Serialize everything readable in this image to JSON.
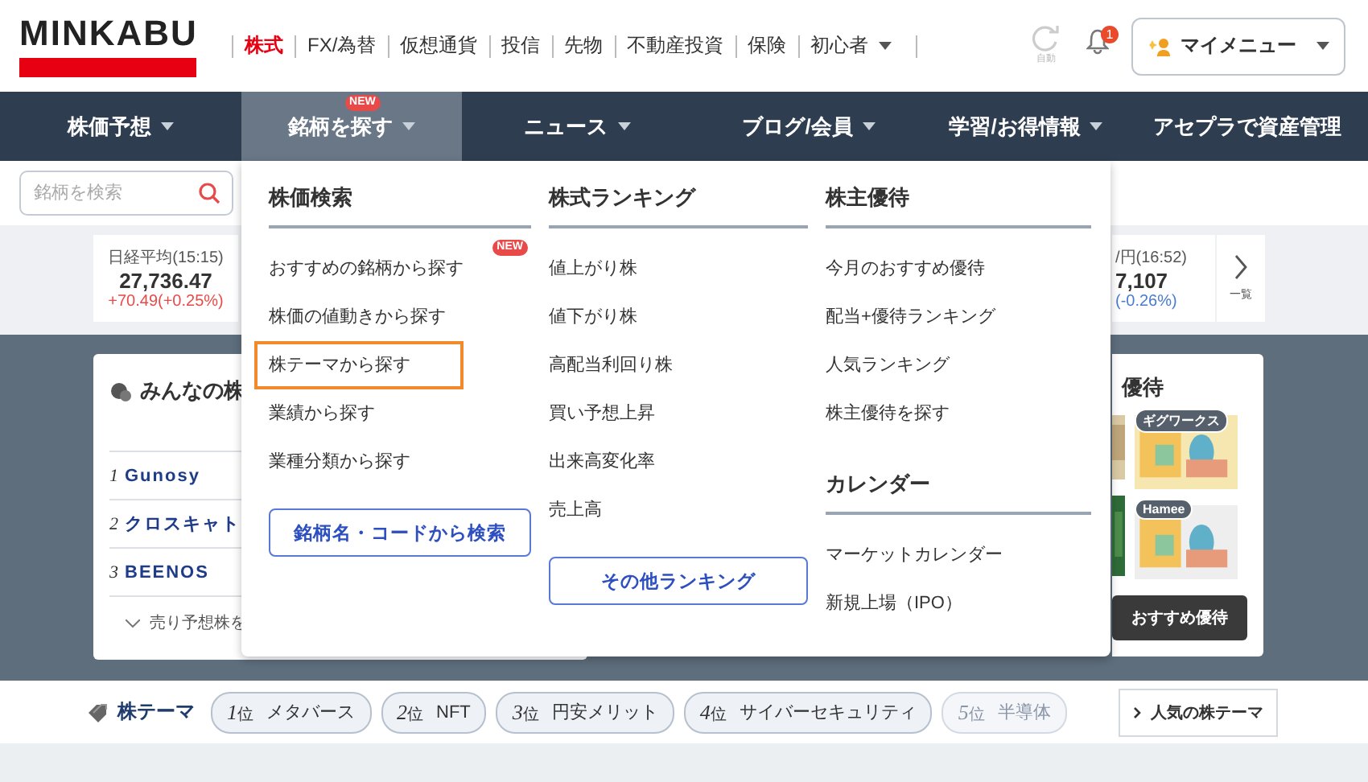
{
  "logo": {
    "text": "MINKABU"
  },
  "top_nav": [
    {
      "label": "株式",
      "selected": true,
      "dropdown": false
    },
    {
      "label": "FX/為替",
      "selected": false,
      "dropdown": false
    },
    {
      "label": "仮想通貨",
      "selected": false,
      "dropdown": false
    },
    {
      "label": "投信",
      "selected": false,
      "dropdown": false
    },
    {
      "label": "先物",
      "selected": false,
      "dropdown": false
    },
    {
      "label": "不動産投資",
      "selected": false,
      "dropdown": false
    },
    {
      "label": "保険",
      "selected": false,
      "dropdown": false
    },
    {
      "label": "初心者",
      "selected": false,
      "dropdown": true
    }
  ],
  "auto_refresh": {
    "label": "自動"
  },
  "notifications": {
    "count": "1"
  },
  "my_menu": {
    "label": "マイメニュー"
  },
  "main_nav": [
    {
      "label": "株価予想",
      "selected": false,
      "dropdown": true
    },
    {
      "label": "銘柄を探す",
      "selected": true,
      "dropdown": true,
      "badge": "NEW"
    },
    {
      "label": "ニュース",
      "selected": false,
      "dropdown": true
    },
    {
      "label": "ブログ/会員",
      "selected": false,
      "dropdown": true
    },
    {
      "label": "学習/お得情報",
      "selected": false,
      "dropdown": true
    },
    {
      "label": "アセプラで資産管理",
      "selected": false,
      "dropdown": false
    }
  ],
  "search": {
    "placeholder": "銘柄を検索"
  },
  "tickers": [
    {
      "name": "日経平均(15:15)",
      "value": "27,736.47",
      "change": "+70.49(+0.25%)",
      "color": "#e84a4a"
    },
    {
      "name": "/円(16:52)",
      "value": "7,107",
      "change": "(-0.26%)",
      "color": "#4a7bd0"
    }
  ],
  "ticker_more": {
    "label": "一覧"
  },
  "community_card": {
    "title": "みんなの株",
    "rows": [
      {
        "rank": "1",
        "name": "Gunosy"
      },
      {
        "rank": "2",
        "name": "クロスキャト"
      },
      {
        "rank": "3",
        "name": "BEENOS"
      }
    ],
    "more": "売り予想株を"
  },
  "benefits_card": {
    "title": "優待",
    "items": [
      {
        "tag": "ギグワークス"
      },
      {
        "tag": "Hamee"
      }
    ],
    "button": "おすすめ優待"
  },
  "dropdown": {
    "columns": [
      {
        "sections": [
          {
            "heading": "株価検索",
            "items": [
              {
                "label": "おすすめの銘柄から探す",
                "badge": "NEW",
                "selected": false
              },
              {
                "label": "株価の値動きから探す",
                "selected": false
              },
              {
                "label": "株テーマから探す",
                "selected": true
              },
              {
                "label": "業績から探す",
                "selected": false
              },
              {
                "label": "業種分類から探す",
                "selected": false
              }
            ]
          }
        ],
        "button": "銘柄名・コードから検索"
      },
      {
        "sections": [
          {
            "heading": "株式ランキング",
            "items": [
              {
                "label": "値上がり株",
                "selected": false
              },
              {
                "label": "値下がり株",
                "selected": false
              },
              {
                "label": "高配当利回り株",
                "selected": false
              },
              {
                "label": "買い予想上昇",
                "selected": false
              },
              {
                "label": "出来高変化率",
                "selected": false
              },
              {
                "label": "売上高",
                "selected": false
              }
            ]
          }
        ],
        "button": "その他ランキング"
      },
      {
        "sections": [
          {
            "heading": "株主優待",
            "items": [
              {
                "label": "今月のおすすめ優待",
                "selected": false
              },
              {
                "label": "配当+優待ランキング",
                "selected": false
              },
              {
                "label": "人気ランキング",
                "selected": false
              },
              {
                "label": "株主優待を探す",
                "selected": false
              }
            ]
          },
          {
            "heading": "カレンダー",
            "items": [
              {
                "label": "マーケットカレンダー",
                "selected": false
              },
              {
                "label": "新規上場（IPO）",
                "selected": false
              }
            ]
          }
        ]
      }
    ]
  },
  "theme_bar": {
    "title": "株テーマ",
    "themes": [
      {
        "rank": "1",
        "rank_unit": "位",
        "label": "メタバース",
        "faded": false
      },
      {
        "rank": "2",
        "rank_unit": "位",
        "label": "NFT",
        "faded": false
      },
      {
        "rank": "3",
        "rank_unit": "位",
        "label": "円安メリット",
        "faded": false
      },
      {
        "rank": "4",
        "rank_unit": "位",
        "label": "サイバーセキュリティ",
        "faded": false
      },
      {
        "rank": "5",
        "rank_unit": "位",
        "label": "半導体",
        "faded": true
      }
    ],
    "more": "人気の株テーマ"
  }
}
